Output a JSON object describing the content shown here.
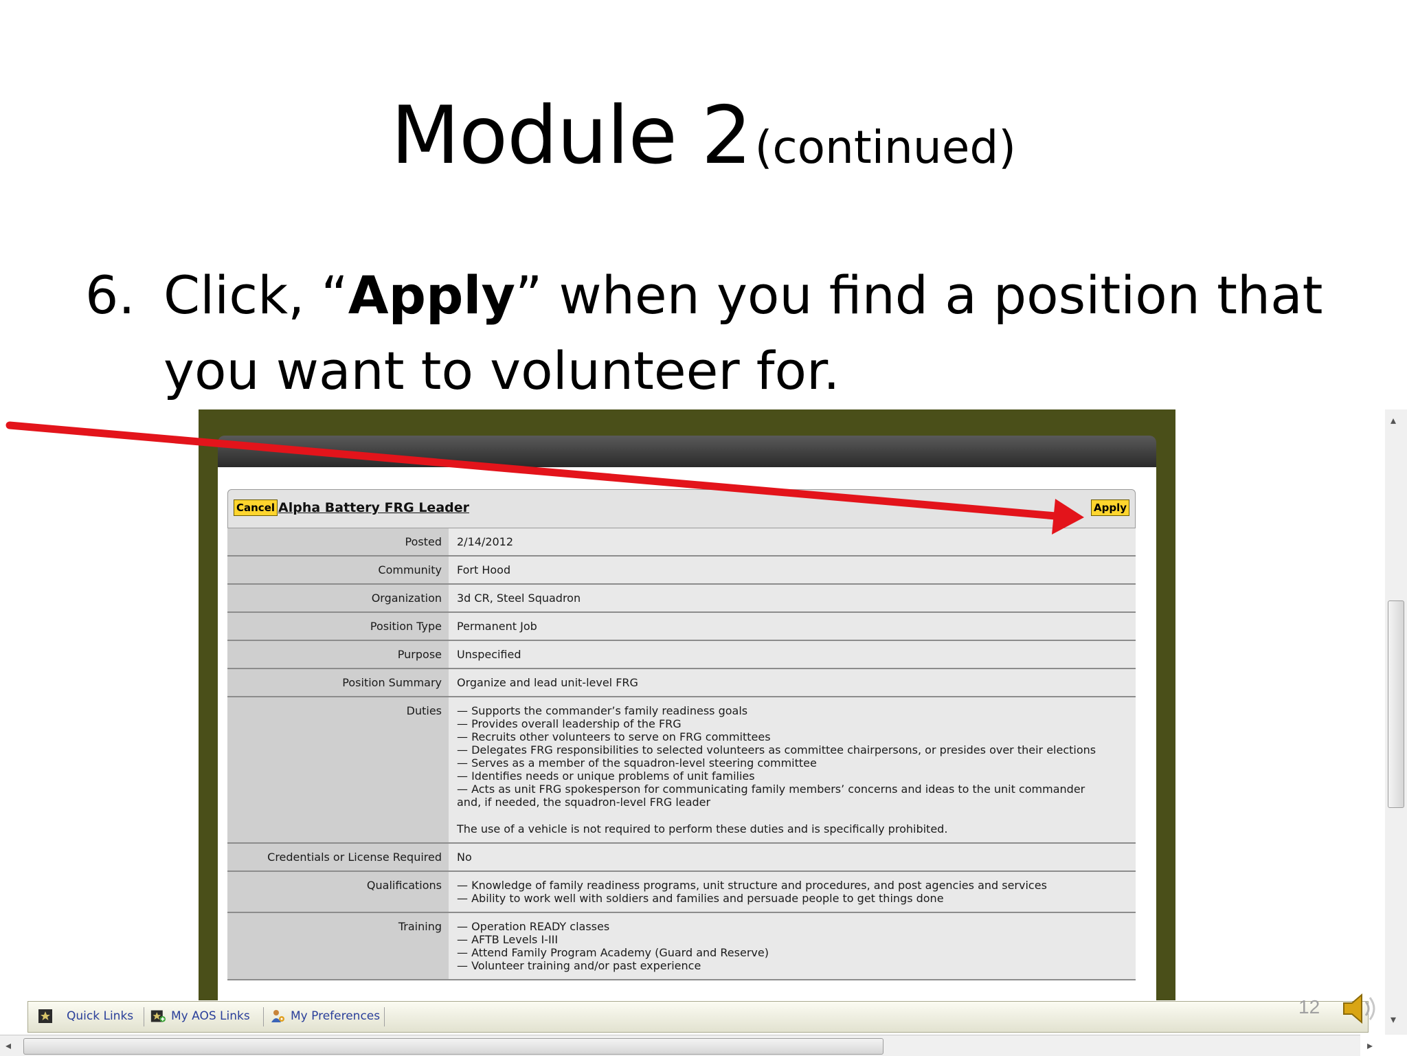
{
  "slide": {
    "title": "Module 2",
    "title_suffix": "(continued)",
    "step_number": "6.",
    "step_text_before": "Click, “",
    "step_text_bold": "Apply",
    "step_text_after": "” when you find a position that",
    "step_text_line2": "you want to volunteer for.",
    "page_number": "12"
  },
  "job": {
    "cancel_label": "Cancel",
    "apply_label": "Apply",
    "title": "Alpha Battery FRG Leader",
    "fields": {
      "posted": {
        "label": "Posted",
        "value": "2/14/2012"
      },
      "community": {
        "label": "Community",
        "value": "Fort Hood"
      },
      "organization": {
        "label": "Organization",
        "value": "3d CR, Steel Squadron"
      },
      "position_type": {
        "label": "Position Type",
        "value": "Permanent Job"
      },
      "purpose": {
        "label": "Purpose",
        "value": "Unspecified"
      },
      "position_summary": {
        "label": "Position Summary",
        "value": "Organize and lead unit-level FRG"
      },
      "duties": {
        "label": "Duties",
        "lines": [
          "— Supports the commander’s family readiness goals",
          "— Provides overall leadership of the FRG",
          "— Recruits other volunteers to serve on FRG committees",
          "— Delegates FRG responsibilities to selected volunteers as committee chairpersons, or presides over their elections",
          "— Serves as a member of the squadron-level steering committee",
          "— Identifies needs or unique problems of unit families",
          "— Acts as unit FRG spokesperson for communicating family members’ concerns and ideas to the unit commander",
          "and, if needed, the squadron-level FRG leader"
        ],
        "note": "The use of a vehicle is not required to perform these duties and is specifically prohibited."
      },
      "credentials": {
        "label": "Credentials or License Required",
        "value": "No"
      },
      "qualifications": {
        "label": "Qualifications",
        "lines": [
          "— Knowledge of family readiness programs, unit structure and procedures, and post agencies and services",
          "— Ability to work well with soldiers and families and persuade people to get things done"
        ]
      },
      "training": {
        "label": "Training",
        "lines": [
          "— Operation READY classes",
          "— AFTB Levels I-III",
          "— Attend Family Program Academy (Guard and Reserve)",
          "— Volunteer training and/or past experience"
        ]
      }
    }
  },
  "toolbar": {
    "quick_links": "Quick Links",
    "my_aos_links": "My AOS Links",
    "my_preferences": "My Preferences"
  },
  "colors": {
    "frame": "#4a4f19",
    "button": "#ffd52e",
    "arrow": "#e3141b",
    "link": "#2a3f9a"
  }
}
